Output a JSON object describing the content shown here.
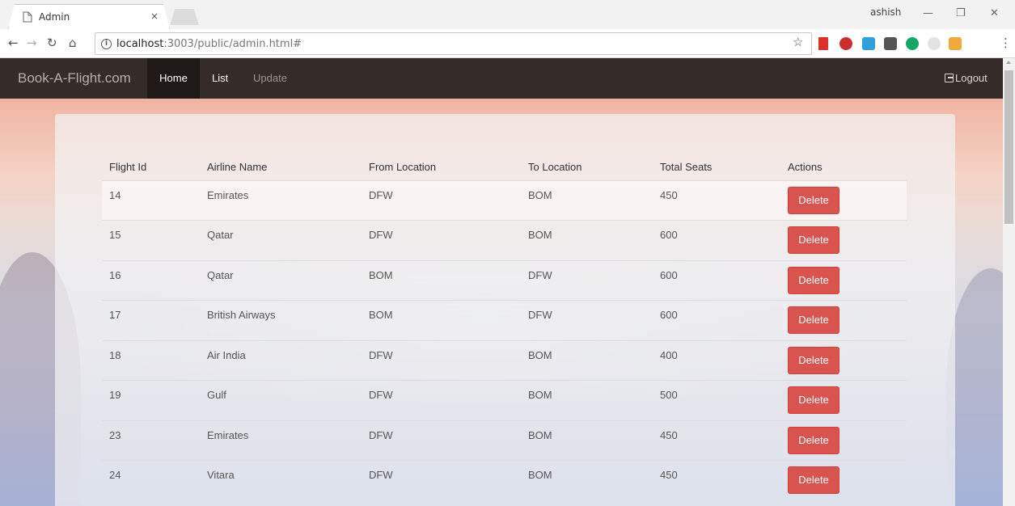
{
  "browser": {
    "tab_title": "Admin",
    "tab_close": "×",
    "profile_name": "ashish",
    "url_host": "localhost",
    "url_path": ":3003/public/admin.html#",
    "icons": [
      "back-icon",
      "forward-icon",
      "reload-icon",
      "home-icon",
      "info-icon",
      "star-icon",
      "menu-icon"
    ]
  },
  "navbar": {
    "brand": "Book-A-Flight.com",
    "items": [
      {
        "label": "Home"
      },
      {
        "label": "List"
      },
      {
        "label": "Update"
      }
    ],
    "logout": "Logout"
  },
  "table": {
    "headers": [
      "Flight Id",
      "Airline Name",
      "From Location",
      "To Location",
      "Total Seats",
      "Actions"
    ],
    "delete_label": "Delete",
    "rows": [
      {
        "id": "14",
        "airline": "Emirates",
        "from": "DFW",
        "to": "BOM",
        "seats": "450"
      },
      {
        "id": "15",
        "airline": "Qatar",
        "from": "DFW",
        "to": "BOM",
        "seats": "600"
      },
      {
        "id": "16",
        "airline": "Qatar",
        "from": "BOM",
        "to": "DFW",
        "seats": "600"
      },
      {
        "id": "17",
        "airline": "British Airways",
        "from": "BOM",
        "to": "DFW",
        "seats": "600"
      },
      {
        "id": "18",
        "airline": "Air India",
        "from": "DFW",
        "to": "BOM",
        "seats": "400"
      },
      {
        "id": "19",
        "airline": "Gulf",
        "from": "DFW",
        "to": "BOM",
        "seats": "500"
      },
      {
        "id": "23",
        "airline": "Emirates",
        "from": "DFW",
        "to": "BOM",
        "seats": "450"
      },
      {
        "id": "24",
        "airline": "Vitara",
        "from": "DFW",
        "to": "BOM",
        "seats": "450"
      }
    ]
  },
  "colors": {
    "navbar": "#352c29",
    "navbar_active": "#1f1a18",
    "danger": "#d9534f"
  }
}
